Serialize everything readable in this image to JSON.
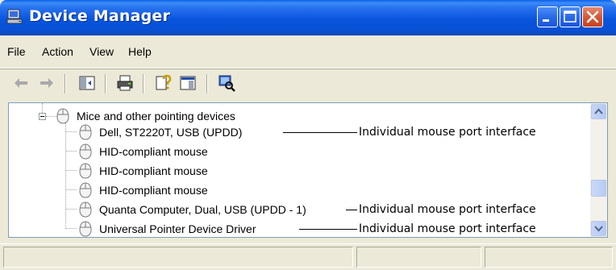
{
  "window": {
    "title": "Device Manager",
    "title_icon": "computer-icon",
    "controls": [
      "minimize-icon",
      "maximize-icon",
      "close-icon"
    ]
  },
  "menu": {
    "items": [
      "File",
      "Action",
      "View",
      "Help"
    ]
  },
  "toolbar": {
    "buttons": [
      "back-arrow-icon",
      "forward-arrow-icon",
      "show-hide-console-tree-icon",
      "print-icon",
      "help-icon",
      "properties-icon",
      "scan-hardware-icon"
    ]
  },
  "tree": {
    "category": "Mice and other pointing devices",
    "devices": [
      {
        "label": "Dell, ST2220T, USB (UPDD)",
        "annotation": "Individual mouse port interface"
      },
      {
        "label": "HID-compliant mouse",
        "annotation": ""
      },
      {
        "label": "HID-compliant mouse",
        "annotation": ""
      },
      {
        "label": "HID-compliant mouse",
        "annotation": ""
      },
      {
        "label": "Quanta Computer, Dual, USB (UPDD - 1)",
        "annotation": "Individual mouse port interface"
      },
      {
        "label": "Universal Pointer Device Driver",
        "annotation": "Individual mouse port interface"
      }
    ]
  },
  "scrollbar": {
    "up_icon": "scroll-up-icon",
    "down_icon": "scroll-down-icon"
  },
  "colors": {
    "titlebar_blue": "#0855DD",
    "close_red": "#D65A35",
    "window_bg": "#ECE9D8"
  }
}
